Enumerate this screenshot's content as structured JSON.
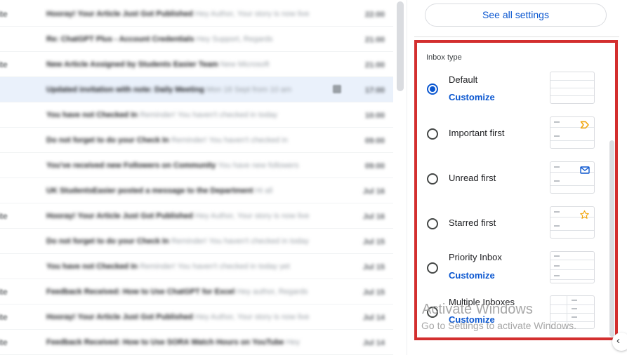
{
  "mail_list": {
    "rows": [
      {
        "prefix": "ite",
        "subject": "Hooray! Your Article Just Got Published",
        "snippet": "Hey Author, Your story is now live",
        "date": "22:00",
        "highlighted": false,
        "icon": false
      },
      {
        "prefix": "",
        "subject": "Re: ChatGPT Plus - Account Credentials",
        "snippet": "Hey Support, Regards",
        "date": "21:00",
        "highlighted": false,
        "icon": false
      },
      {
        "prefix": "ite",
        "subject": "New Article Assigned by Students Easier Team",
        "snippet": "New Microsoft",
        "date": "21:00",
        "highlighted": false,
        "icon": false
      },
      {
        "prefix": "",
        "subject": "Updated invitation with note: Daily Meeting",
        "snippet": "Mon 18 Sept from 10 am",
        "date": "17:00",
        "highlighted": true,
        "icon": true
      },
      {
        "prefix": "",
        "subject": "You have not Checked In",
        "snippet": "Reminder! You haven't checked in today",
        "date": "10:00",
        "highlighted": false,
        "icon": false
      },
      {
        "prefix": "",
        "subject": "Do not forget to do your Check In",
        "snippet": "Reminder! You haven't checked in",
        "date": "09:00",
        "highlighted": false,
        "icon": false
      },
      {
        "prefix": "",
        "subject": "You've received new Followers on Community",
        "snippet": "You have new followers",
        "date": "09:00",
        "highlighted": false,
        "icon": false
      },
      {
        "prefix": "",
        "subject": "UK StudentsEasier posted a message to the Department",
        "snippet": "Hi all",
        "date": "Jul 16",
        "highlighted": false,
        "icon": false
      },
      {
        "prefix": "ite",
        "subject": "Hooray! Your Article Just Got Published",
        "snippet": "Hey Author, Your story is now live",
        "date": "Jul 16",
        "highlighted": false,
        "icon": false
      },
      {
        "prefix": "",
        "subject": "Do not forget to do your Check In",
        "snippet": "Reminder! You haven't checked in today",
        "date": "Jul 15",
        "highlighted": false,
        "icon": false
      },
      {
        "prefix": "",
        "subject": "You have not Checked In",
        "snippet": "Reminder! You haven't checked in today yet",
        "date": "Jul 15",
        "highlighted": false,
        "icon": false
      },
      {
        "prefix": "ite",
        "subject": "Feedback Received: How to Use ChatGPT for Excel",
        "snippet": "Hey author, Regards",
        "date": "Jul 15",
        "highlighted": false,
        "icon": false
      },
      {
        "prefix": "ite",
        "subject": "Hooray! Your Article Just Got Published",
        "snippet": "Hey Author, Your story is now live",
        "date": "Jul 14",
        "highlighted": false,
        "icon": false
      },
      {
        "prefix": "ite",
        "subject": "Feedback Received: How to Use SORA Watch Hours on YouTube",
        "snippet": "Hey",
        "date": "Jul 14",
        "highlighted": false,
        "icon": false
      }
    ]
  },
  "quick_settings": {
    "see_all_label": "See all settings",
    "inbox_type_heading": "Inbox type",
    "options": [
      {
        "label": "Default",
        "customize": "Customize",
        "selected": true,
        "thumb_icon": "none"
      },
      {
        "label": "Important first",
        "customize": "",
        "selected": false,
        "thumb_icon": "important-marker-icon"
      },
      {
        "label": "Unread first",
        "customize": "",
        "selected": false,
        "thumb_icon": "envelope-icon"
      },
      {
        "label": "Starred first",
        "customize": "",
        "selected": false,
        "thumb_icon": "star-icon"
      },
      {
        "label": "Priority Inbox",
        "customize": "Customize",
        "selected": false,
        "thumb_icon": "none"
      },
      {
        "label": "Multiple Inboxes",
        "customize": "Customize",
        "selected": false,
        "thumb_icon": "none"
      }
    ],
    "colors": {
      "accent": "#0b57d0",
      "highlight_border": "#d32f2f",
      "important": "#f2a60c",
      "star": "#f2a60c"
    }
  },
  "watermark": {
    "title": "Activate Windows",
    "subtitle": "Go to Settings to activate Windows."
  },
  "collapse_glyph": "‹"
}
